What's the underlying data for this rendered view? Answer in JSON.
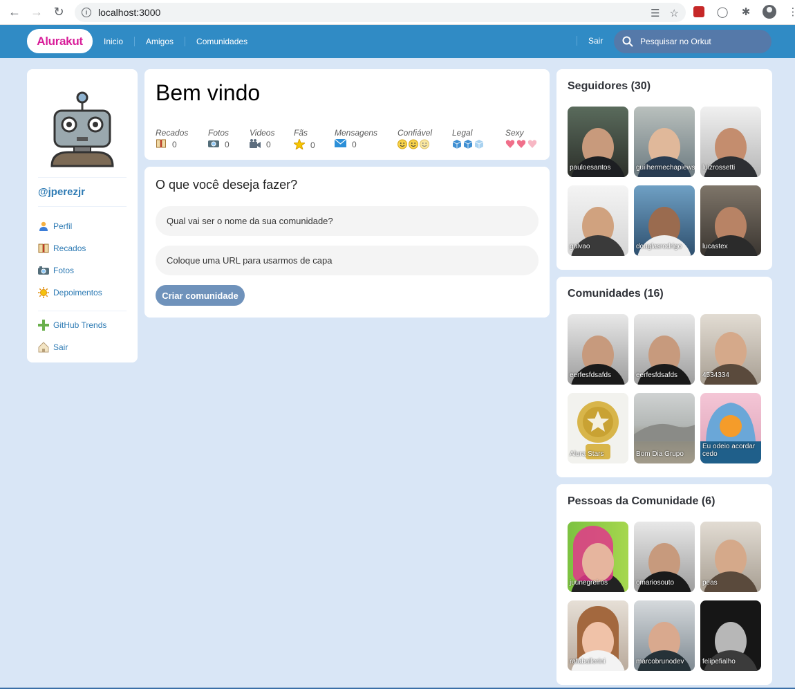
{
  "browser": {
    "url": "localhost:3000"
  },
  "topmenu": {
    "logo": "Alurakut",
    "links": [
      "Inicio",
      "Amigos",
      "Comunidades"
    ],
    "logout": "Sair",
    "search_placeholder": "Pesquisar no Orkut"
  },
  "profile": {
    "username": "@jperezjr",
    "items": [
      {
        "label": "Perfil",
        "icon": "user-icon"
      },
      {
        "label": "Recados",
        "icon": "book-icon"
      },
      {
        "label": "Fotos",
        "icon": "camera-icon"
      },
      {
        "label": "Depoimentos",
        "icon": "sun-icon"
      }
    ],
    "items2": [
      {
        "label": "GitHub Trends",
        "icon": "plus-icon"
      },
      {
        "label": "Sair",
        "icon": "home-icon"
      }
    ]
  },
  "welcome": {
    "title": "Bem vindo",
    "stats": [
      {
        "label": "Recados",
        "value": "0",
        "icon": "book-icon"
      },
      {
        "label": "Fotos",
        "value": "0",
        "icon": "camera-icon"
      },
      {
        "label": "Videos",
        "value": "0",
        "icon": "video-icon"
      },
      {
        "label": "Fãs",
        "value": "0",
        "icon": "star-icon"
      },
      {
        "label": "Mensagens",
        "value": "0",
        "icon": "mail-icon"
      }
    ],
    "ratings": [
      {
        "label": "Confiável",
        "icon": "smile-icon",
        "count": 3
      },
      {
        "label": "Legal",
        "icon": "cube-icon",
        "count": 3
      },
      {
        "label": "Sexy",
        "icon": "heart-icon",
        "count": 3
      }
    ]
  },
  "form": {
    "title": "O que você deseja fazer?",
    "name_placeholder": "Qual vai ser o nome da sua comunidade?",
    "url_placeholder": "Coloque uma URL para usarmos de capa",
    "submit": "Criar comunidade"
  },
  "followers": {
    "title": "Seguidores (30)",
    "items": [
      "pauloesantos",
      "guilhermechapiewski",
      "luizrossetti",
      "galvao",
      "douglasrodrigo",
      "lucastex"
    ]
  },
  "communities": {
    "title": "Comunidades (16)",
    "items": [
      "eerfesfdsafds",
      "eerfesfdsafds",
      "4534334",
      "Alura Stars",
      "Bom Dia Grupo",
      "Eu odeio acordar cedo"
    ]
  },
  "people": {
    "title": "Pessoas da Comunidade (6)",
    "items": [
      "juunegreiros",
      "omariosouto",
      "peas",
      "rafaballerini",
      "marcobrunodev",
      "felipefialho"
    ]
  },
  "colors": {
    "menu": "#308bc5",
    "background": "#d9e6f6",
    "link": "#2e7bb4",
    "logo": "#d81d99",
    "button": "#6f92bb"
  }
}
